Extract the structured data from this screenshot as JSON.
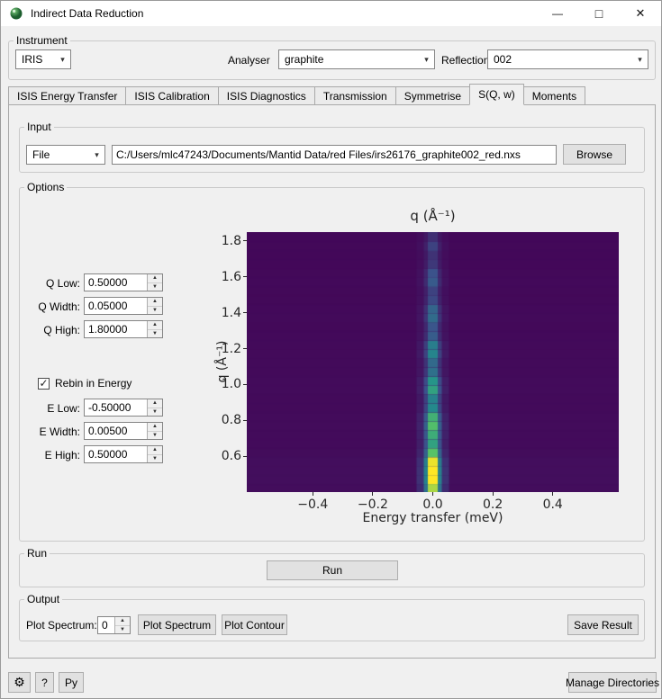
{
  "window": {
    "title": "Indirect Data Reduction"
  },
  "icons": {
    "dropdown": "▾",
    "spin_up": "▲",
    "spin_down": "▼",
    "gear": "⚙",
    "check": "✓",
    "minimize": "—",
    "maximize": "□",
    "close": "✕"
  },
  "instrument_panel": {
    "legend": "Instrument",
    "instrument_value": "IRIS",
    "analyser_label": "Analyser",
    "analyser_value": "graphite",
    "reflection_label": "Reflection",
    "reflection_value": "002"
  },
  "tabs": {
    "selected": "S(Q, w)",
    "items": [
      {
        "label": "ISIS Energy Transfer"
      },
      {
        "label": "ISIS Calibration"
      },
      {
        "label": "ISIS Diagnostics"
      },
      {
        "label": "Transmission"
      },
      {
        "label": "Symmetrise"
      },
      {
        "label": "S(Q, w)"
      },
      {
        "label": "Moments"
      }
    ]
  },
  "input_panel": {
    "legend": "Input",
    "source_selector_value": "File",
    "file_path": "C:/Users/mlc47243/Documents/Mantid Data/red Files/irs26176_graphite002_red.nxs",
    "browse_label": "Browse"
  },
  "options_panel": {
    "legend": "Options",
    "q_low_label": "Q Low:",
    "q_low_value": "0.50000",
    "q_width_label": "Q Width:",
    "q_width_value": "0.05000",
    "q_high_label": "Q High:",
    "q_high_value": "1.80000",
    "rebin_label": "Rebin in Energy",
    "rebin_checked": true,
    "e_low_label": "E Low:",
    "e_low_value": "-0.50000",
    "e_width_label": "E Width:",
    "e_width_value": "0.00500",
    "e_high_label": "E High:",
    "e_high_value": "0.50000"
  },
  "run_panel": {
    "legend": "Run",
    "run_label": "Run"
  },
  "output_panel": {
    "legend": "Output",
    "plot_spectrum_label": "Plot Spectrum:",
    "plot_spectrum_value": "0",
    "plot_spectrum_button": "Plot Spectrum",
    "plot_contour_button": "Plot Contour",
    "save_result_button": "Save Result"
  },
  "footer": {
    "help_label": "?",
    "py_label": "Py",
    "manage_directories_label": "Manage Directories"
  },
  "chart_data": {
    "type": "heatmap",
    "title": "q (Å⁻¹)",
    "xlabel": "Energy transfer (meV)",
    "ylabel": "q (Å⁻¹)",
    "xlim": [
      -0.62,
      0.62
    ],
    "ylim": [
      0.4,
      1.85
    ],
    "x_tick_values": [
      -0.4,
      -0.2,
      0.0,
      0.2,
      0.4
    ],
    "x_tick_labels": [
      "−0.4",
      "−0.2",
      "0.0",
      "0.2",
      "0.4"
    ],
    "y_tick_values": [
      0.6,
      0.8,
      1.0,
      1.2,
      1.4,
      1.6,
      1.8
    ],
    "y_tick_labels": [
      "0.6",
      "0.8",
      "1.0",
      "1.2",
      "1.4",
      "1.6",
      "1.8"
    ],
    "colormap": "viridis",
    "colormap_stops": [
      "#440154",
      "#3b528b",
      "#21918c",
      "#5ec962",
      "#fde725"
    ],
    "background_value": 0.02,
    "elastic_line_x": 0.0,
    "q_start": 0.4,
    "q_step": 0.05,
    "line_profile": [
      0.85,
      1.0,
      1.0,
      0.95,
      0.7,
      0.55,
      0.6,
      0.68,
      0.62,
      0.45,
      0.42,
      0.55,
      0.5,
      0.35,
      0.32,
      0.43,
      0.4,
      0.27,
      0.24,
      0.33,
      0.3,
      0.2,
      0.18,
      0.26,
      0.23,
      0.15,
      0.13,
      0.18,
      0.12
    ],
    "line_bands": [
      [
        36,
        0.13
      ],
      [
        20,
        0.42
      ],
      [
        11,
        1.0
      ]
    ]
  }
}
